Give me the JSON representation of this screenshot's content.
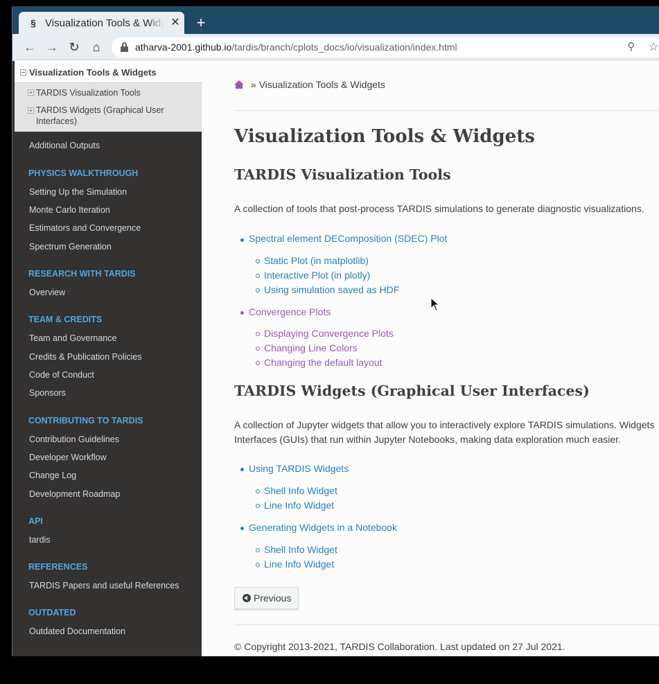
{
  "browser": {
    "tab_title": "Visualization Tools & Widgets",
    "tab_favicon": "tardis-favicon",
    "url_host": "atharva-2001.github.io",
    "url_path": "/tardis/branch/cplots_docs/io/visualization/index.html"
  },
  "sidebar": {
    "current": {
      "label": "Visualization Tools & Widgets",
      "children": [
        "TARDIS Visualization Tools",
        "TARDIS Widgets (Graphical User Interfaces)"
      ]
    },
    "after_current": "Additional Outputs",
    "sections": [
      {
        "caption": "PHYSICS WALKTHROUGH",
        "items": [
          "Setting Up the Simulation",
          "Monte Carlo Iteration",
          "Estimators and Convergence",
          "Spectrum Generation"
        ]
      },
      {
        "caption": "RESEARCH WITH TARDIS",
        "items": [
          "Overview"
        ]
      },
      {
        "caption": "TEAM & CREDITS",
        "items": [
          "Team and Governance",
          "Credits & Publication Policies",
          "Code of Conduct",
          "Sponsors"
        ]
      },
      {
        "caption": "CONTRIBUTING TO TARDIS",
        "items": [
          "Contribution Guidelines",
          "Developer Workflow",
          "Change Log",
          "Development Roadmap"
        ]
      },
      {
        "caption": "API",
        "items": [
          "tardis"
        ]
      },
      {
        "caption": "REFERENCES",
        "items": [
          "TARDIS Papers and useful References"
        ]
      },
      {
        "caption": "OUTDATED",
        "items": [
          "Outdated Documentation"
        ]
      }
    ]
  },
  "content": {
    "breadcrumb_sep": "»",
    "breadcrumb_current": "Visualization Tools & Widgets",
    "title": "Visualization Tools & Widgets",
    "section1": {
      "heading": "TARDIS Visualization Tools",
      "text": "A collection of tools that post-process TARDIS simulations to generate diagnostic visualizations.",
      "items": [
        {
          "label": "Spectral element DEComposition (SDEC) Plot",
          "children": [
            "Static Plot (in matplotlib)",
            "Interactive Plot (in plotly)",
            "Using simulation saved as HDF"
          ]
        },
        {
          "label": "Convergence Plots",
          "children": [
            "Displaying Convergence Plots",
            "Changing Line Colors",
            "Changing the default layout"
          ]
        }
      ]
    },
    "section2": {
      "heading": "TARDIS Widgets (Graphical User Interfaces)",
      "text_line1": "A collection of Jupyter widgets that allow you to interactively explore TARDIS simulations. Widgets",
      "text_line2": "Interfaces (GUIs) that run within Jupyter Notebooks, making data exploration much easier.",
      "items": [
        {
          "label": "Using TARDIS Widgets",
          "children": [
            "Shell Info Widget",
            "Line Info Widget"
          ]
        },
        {
          "label": "Generating Widgets in a Notebook",
          "children": [
            "Shell Info Widget",
            "Line Info Widget"
          ]
        }
      ]
    },
    "prev_label": "Previous",
    "footer": "© Copyright 2013-2021, TARDIS Collaboration. Last updated on 27 Jul 2021."
  }
}
